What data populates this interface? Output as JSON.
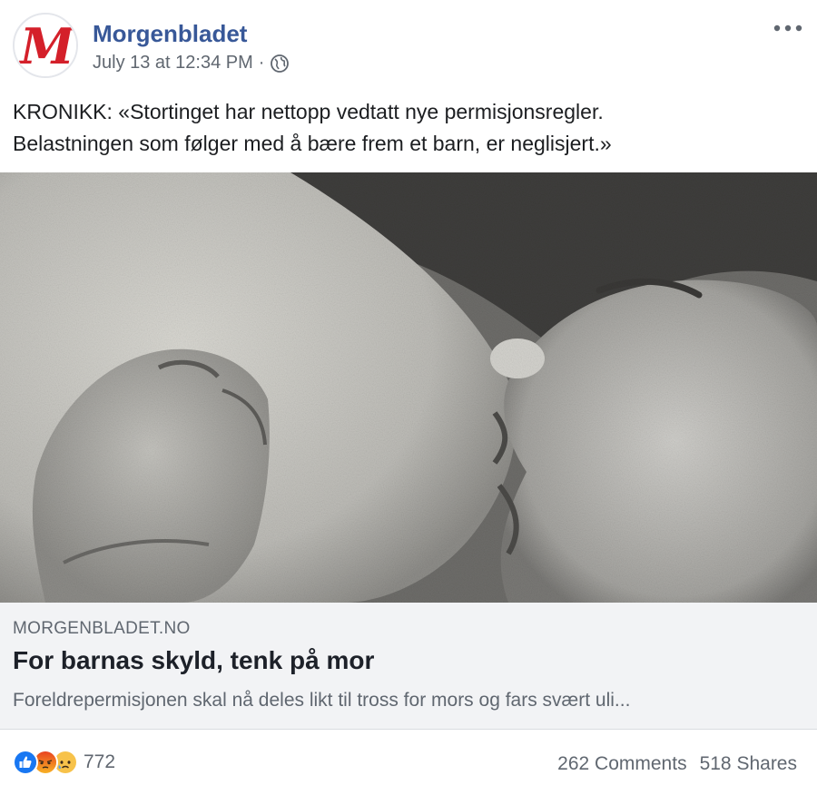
{
  "header": {
    "page_name": "Morgenbladet",
    "timestamp": "July 13 at 12:34 PM",
    "separator": "·",
    "privacy_icon": "globe-icon",
    "more_icon": "more-options-icon",
    "logo_letter": "M"
  },
  "post": {
    "text_line1": "KRONIKK: «Stortinget har nettopp vedtatt nye permisjonsregler.",
    "text_line2": "Belastningen som følger med å bære frem et barn, er neglisjert.»"
  },
  "link_preview": {
    "domain": "MORGENBLADET.NO",
    "title": "For barnas skyld, tenk på mor",
    "description": "Foreldrepermisjonen skal nå deles likt til tross for mors og fars svært uli..."
  },
  "footer": {
    "reaction_icons": [
      "like-icon",
      "angry-icon",
      "sad-icon"
    ],
    "reaction_count": "772",
    "comments": "262 Comments",
    "shares": "518 Shares"
  },
  "colors": {
    "brand_link": "#385898",
    "logo_red": "#d4202a",
    "like_blue": "#1877f2"
  }
}
